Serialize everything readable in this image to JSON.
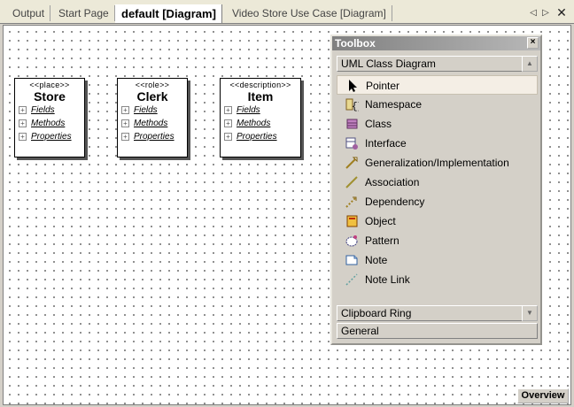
{
  "tabs": [
    {
      "label": "Output"
    },
    {
      "label": "Start Page"
    },
    {
      "label": "default [Diagram]"
    },
    {
      "label": "Video Store Use Case [Diagram]"
    }
  ],
  "nav": {
    "prev": "◁",
    "next": "▷",
    "close": "✕"
  },
  "classes": [
    {
      "stereotype": "<<place>>",
      "name": "Store",
      "fields": "Fields",
      "methods": "Methods",
      "properties": "Properties"
    },
    {
      "stereotype": "<<role>>",
      "name": "Clerk",
      "fields": "Fields",
      "methods": "Methods",
      "properties": "Properties"
    },
    {
      "stereotype": "<<description>>",
      "name": "Item",
      "fields": "Fields",
      "methods": "Methods",
      "properties": "Properties"
    }
  ],
  "toolbox": {
    "title": "Toolbox",
    "close": "×",
    "category_top": "UML Class Diagram",
    "items": [
      {
        "label": "Pointer",
        "icon": "pointer-icon"
      },
      {
        "label": "Namespace",
        "icon": "namespace-icon"
      },
      {
        "label": "Class",
        "icon": "class-icon"
      },
      {
        "label": "Interface",
        "icon": "interface-icon"
      },
      {
        "label": "Generalization/Implementation",
        "icon": "generalization-icon"
      },
      {
        "label": "Association",
        "icon": "association-icon"
      },
      {
        "label": "Dependency",
        "icon": "dependency-icon"
      },
      {
        "label": "Object",
        "icon": "object-icon"
      },
      {
        "label": "Pattern",
        "icon": "pattern-icon"
      },
      {
        "label": "Note",
        "icon": "note-icon"
      },
      {
        "label": "Note Link",
        "icon": "note-link-icon"
      }
    ],
    "category_clipboard": "Clipboard Ring",
    "category_general": "General"
  },
  "overview_label": "Overview",
  "plus": "+"
}
